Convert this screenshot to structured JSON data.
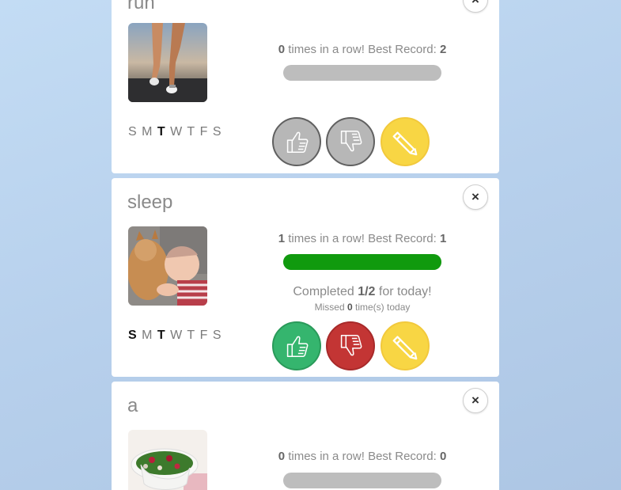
{
  "habits": [
    {
      "title": "run",
      "streak": "0",
      "best": "2",
      "progress": 0,
      "days": [
        "S",
        "M",
        "T",
        "W",
        "T",
        "F",
        "S"
      ],
      "active_days": [
        2
      ],
      "state": "neutral",
      "photo": "running-legs-photo"
    },
    {
      "title": "sleep",
      "streak": "1",
      "best": "1",
      "progress": 1.0,
      "status_prefix": "Completed",
      "status_count": "1/2",
      "status_suffix": "for today!",
      "missed_prefix": "Missed",
      "missed_count": "0",
      "missed_suffix": "time(s) today",
      "days": [
        "S",
        "M",
        "T",
        "W",
        "T",
        "F",
        "S"
      ],
      "active_days": [
        0,
        2
      ],
      "state": "active",
      "photo": "cat-and-baby-photo"
    },
    {
      "title": "a",
      "streak": "0",
      "best": "0",
      "progress": 0,
      "photo": "salad-bowl-photo"
    }
  ],
  "labels": {
    "streak_mid": "times in a row! Best Record:",
    "close": "×"
  },
  "colors": {
    "progress_fill": "#109a0e",
    "progress_track": "#bdbdbd",
    "thumbs_up_active": "#35b56e",
    "thumbs_down_active": "#c33534",
    "edit": "#f8d644",
    "neutral": "#b7b7b7"
  },
  "icons": {
    "close": "close-icon",
    "up": "thumbs-up-icon",
    "down": "thumbs-down-icon",
    "edit": "pencil-icon"
  }
}
